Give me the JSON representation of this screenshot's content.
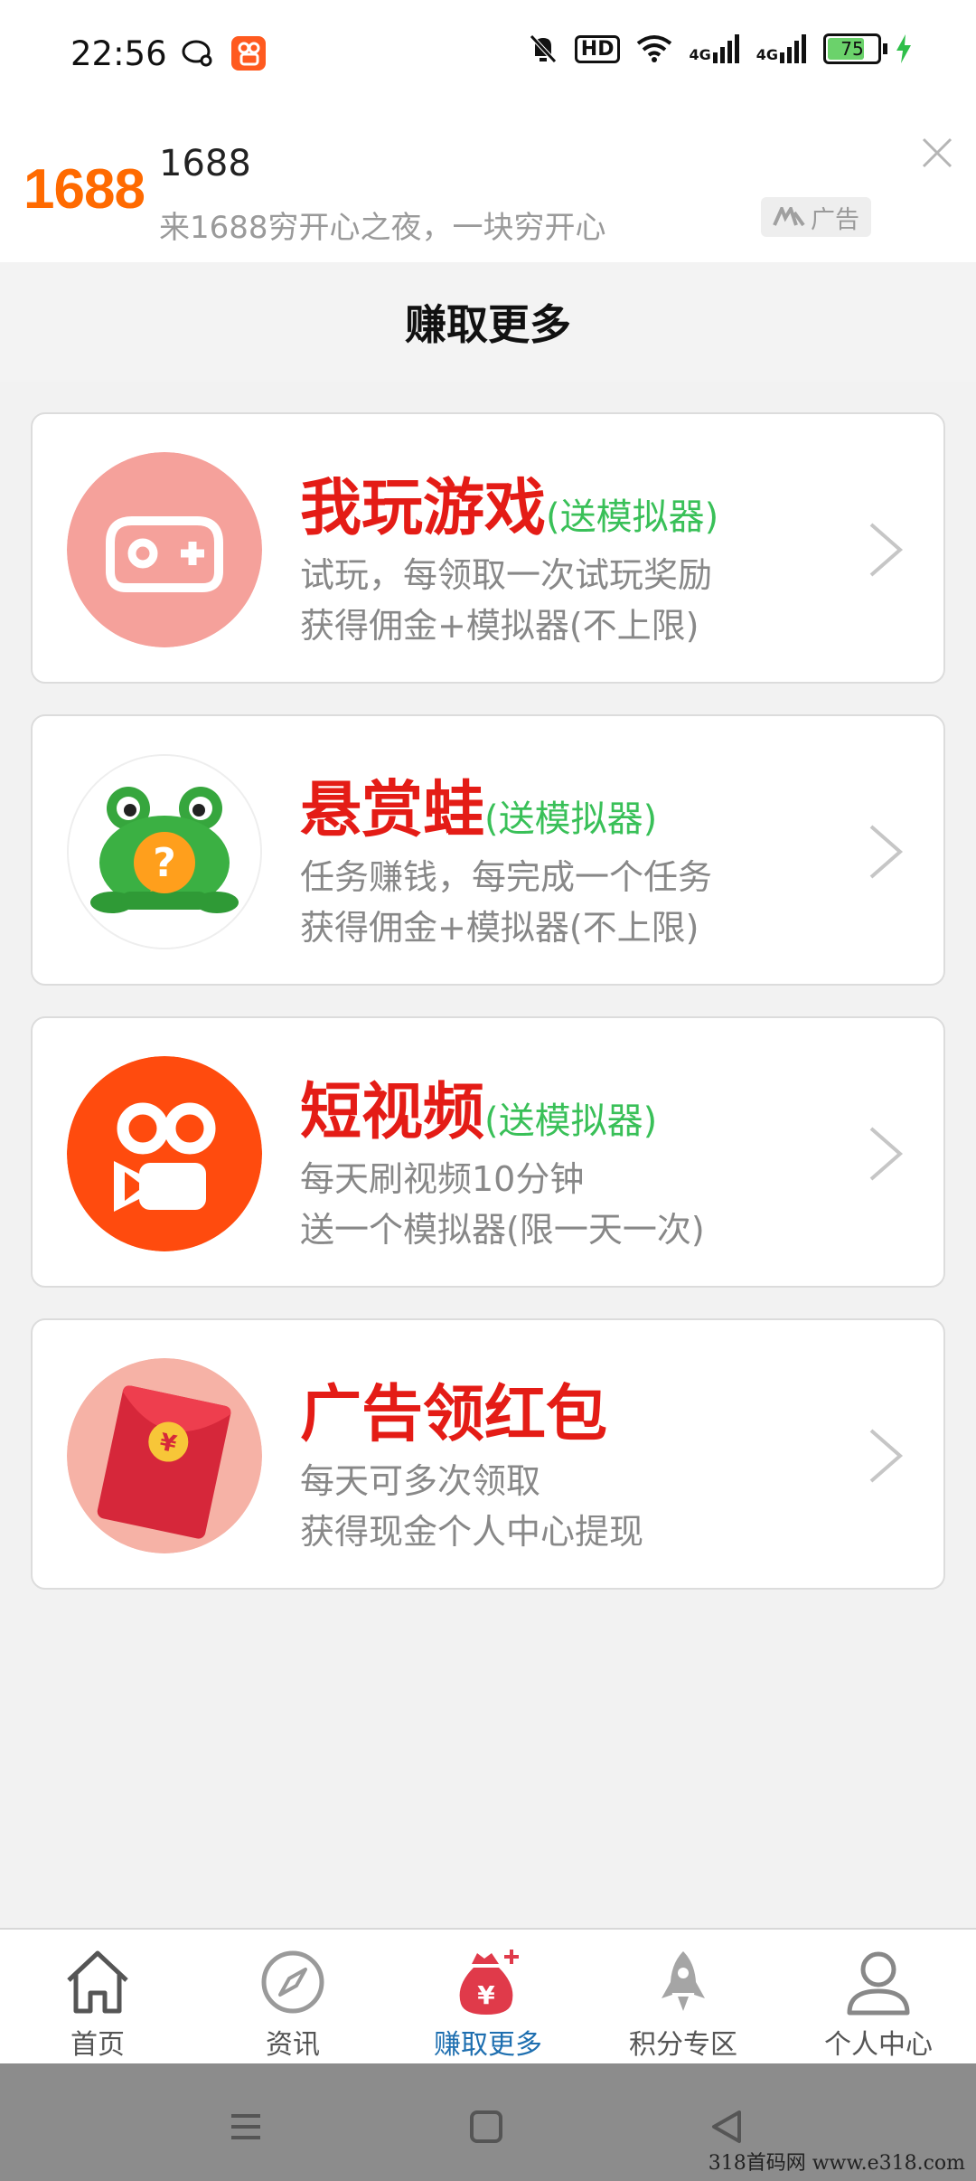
{
  "status_bar": {
    "time": "22:56",
    "hd_label": "HD",
    "net1": "4G",
    "net2": "4G",
    "battery": "75",
    "battery_level": 0.75
  },
  "ad": {
    "logo_text": "1688",
    "title": "1688",
    "description": "来1688穷开心之夜，一块穷开心",
    "tag": "广告"
  },
  "header": {
    "title": "赚取更多"
  },
  "cards": [
    {
      "title": "我玩游戏",
      "tag": "(送模拟器)",
      "desc1": "试玩，每领取一次试玩奖励",
      "desc2": "获得佣金+模拟器(不上限)",
      "icon": "gamepad-icon"
    },
    {
      "title": "悬赏蛙",
      "tag": "(送模拟器)",
      "desc1": "任务赚钱，每完成一个任务",
      "desc2": "获得佣金+模拟器(不上限)",
      "icon": "frog-icon"
    },
    {
      "title": "短视频",
      "tag": "(送模拟器)",
      "desc1": "每天刷视频10分钟",
      "desc2": "送一个模拟器(限一天一次)",
      "icon": "video-camera-icon"
    },
    {
      "title": "广告领红包",
      "tag": "",
      "desc1": "每天可多次领取",
      "desc2": "获得现金个人中心提现",
      "icon": "red-envelope-icon"
    }
  ],
  "tabs": [
    {
      "label": "首页",
      "icon": "home-icon"
    },
    {
      "label": "资讯",
      "icon": "compass-icon"
    },
    {
      "label": "赚取更多",
      "icon": "money-bag-icon",
      "active": true
    },
    {
      "label": "积分专区",
      "icon": "rocket-icon"
    },
    {
      "label": "个人中心",
      "icon": "person-icon"
    }
  ],
  "watermark": "318首码网    www.e318.com",
  "colors": {
    "accent_red": "#e41c16",
    "tag_green": "#39c058",
    "active_tab": "#1e6fb0",
    "brand_orange": "#ff6a00"
  }
}
